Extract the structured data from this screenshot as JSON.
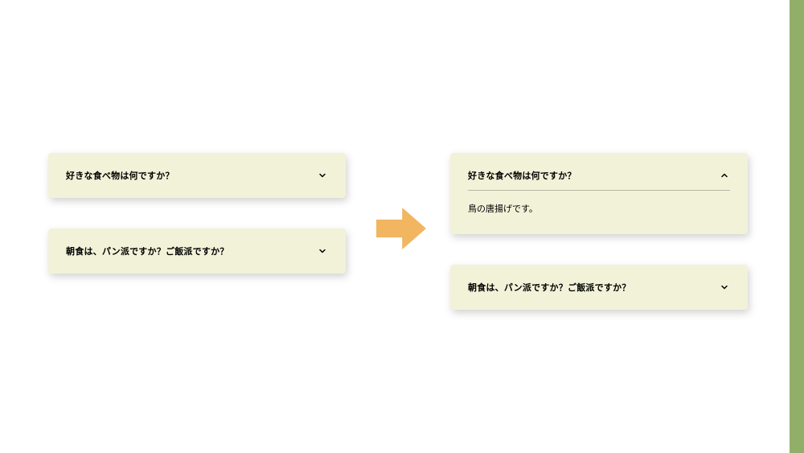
{
  "left": {
    "cards": [
      {
        "title": "好きな食べ物は何ですか？",
        "open": false
      },
      {
        "title": "朝食は、パン派ですか？ご飯派ですか？",
        "open": false
      }
    ]
  },
  "right": {
    "cards": [
      {
        "title": "好きな食べ物は何ですか？",
        "open": true,
        "body": "鳥の唐揚げです。"
      },
      {
        "title": "朝食は、パン派ですか？ご飯派ですか？",
        "open": false
      }
    ]
  }
}
